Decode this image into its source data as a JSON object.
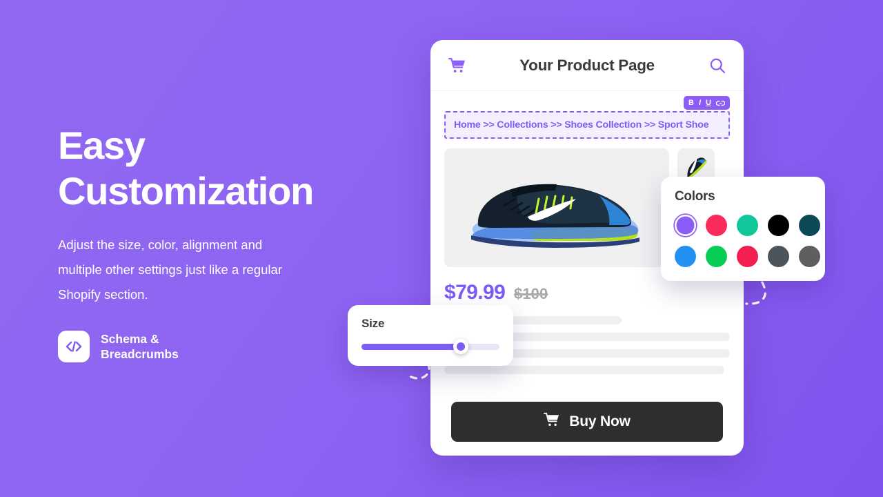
{
  "background": {
    "gradient_from": "#9068f0",
    "gradient_to": "#7f53ef"
  },
  "left_panel": {
    "headline_line1": "Easy",
    "headline_line2": "Customization",
    "subcopy": "Adjust the size, color, alignment and multiple other settings just like a regular Shopify section.",
    "feature": {
      "icon": "code-icon",
      "label": "Schema &\nBreadcrumbs"
    }
  },
  "product_card": {
    "header": {
      "cart_icon": "shopping-cart-icon",
      "title": "Your Product Page",
      "search_icon": "search-icon"
    },
    "format_toolbar": {
      "bold": "B",
      "italic": "I",
      "underline": "U",
      "link": "link-icon",
      "accent": "#8b5cf6"
    },
    "breadcrumb": {
      "text": "Home >> Collections  >> Shoes Collection  >> Sport Shoe",
      "color": "#7c5cf5",
      "border_style": "dashed"
    },
    "gallery": {
      "main_image_alt": "sport-shoe-main",
      "thumbnail_alt": "sport-shoe-thumbnail"
    },
    "price": {
      "current": "$79.99",
      "original": "$100",
      "current_color": "#7c5cf5",
      "original_color": "#a9a9ad"
    },
    "description_placeholder_widths": [
      "62%",
      "100%",
      "100%",
      "98%"
    ],
    "buy_button": {
      "label": "Buy Now",
      "icon": "shopping-cart-icon",
      "background": "#2e2e2e"
    }
  },
  "colors_panel": {
    "title": "Colors",
    "swatches": [
      {
        "name": "purple",
        "hex": "#8b5cf6",
        "selected": true
      },
      {
        "name": "crimson",
        "hex": "#fa2a5c",
        "selected": false
      },
      {
        "name": "teal-green",
        "hex": "#10c79a",
        "selected": false
      },
      {
        "name": "black",
        "hex": "#000000",
        "selected": false
      },
      {
        "name": "dark-teal",
        "hex": "#0d4856",
        "selected": false
      },
      {
        "name": "blue",
        "hex": "#2391f2",
        "selected": false
      },
      {
        "name": "green",
        "hex": "#07cc55",
        "selected": false
      },
      {
        "name": "red-pink",
        "hex": "#f31e52",
        "selected": false
      },
      {
        "name": "slate-gray",
        "hex": "#4c545c",
        "selected": false
      },
      {
        "name": "gray",
        "hex": "#5f5f5f",
        "selected": false
      }
    ]
  },
  "size_panel": {
    "title": "Size",
    "slider": {
      "fill_percent": 72,
      "fill_color": "#7c5cf5",
      "track_color": "#e7e4f7"
    }
  }
}
